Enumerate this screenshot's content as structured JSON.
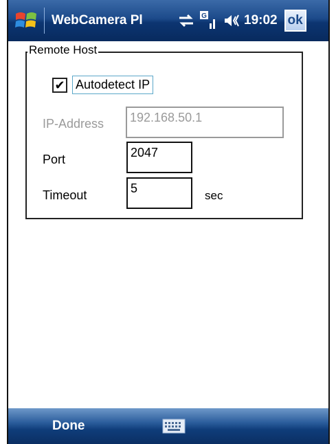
{
  "titlebar": {
    "app_title": "WebCamera Pl",
    "clock": "19:02",
    "ok_label": "ok",
    "signal_badge": "G"
  },
  "group": {
    "label": "Remote Host"
  },
  "autodetect": {
    "label": "Autodetect IP",
    "checked": true,
    "check_glyph": "✔"
  },
  "ip": {
    "label": "IP-Address",
    "value": "192.168.50.1",
    "enabled": false
  },
  "port": {
    "label": "Port",
    "value": "2047"
  },
  "timeout": {
    "label": "Timeout",
    "value": "5",
    "unit": "sec"
  },
  "menubar": {
    "left_softkey": "Done"
  },
  "colors": {
    "titlebar": "#1c4a8a",
    "disabled_text": "#9a9a9a",
    "focus_border": "#5aa7c9"
  }
}
